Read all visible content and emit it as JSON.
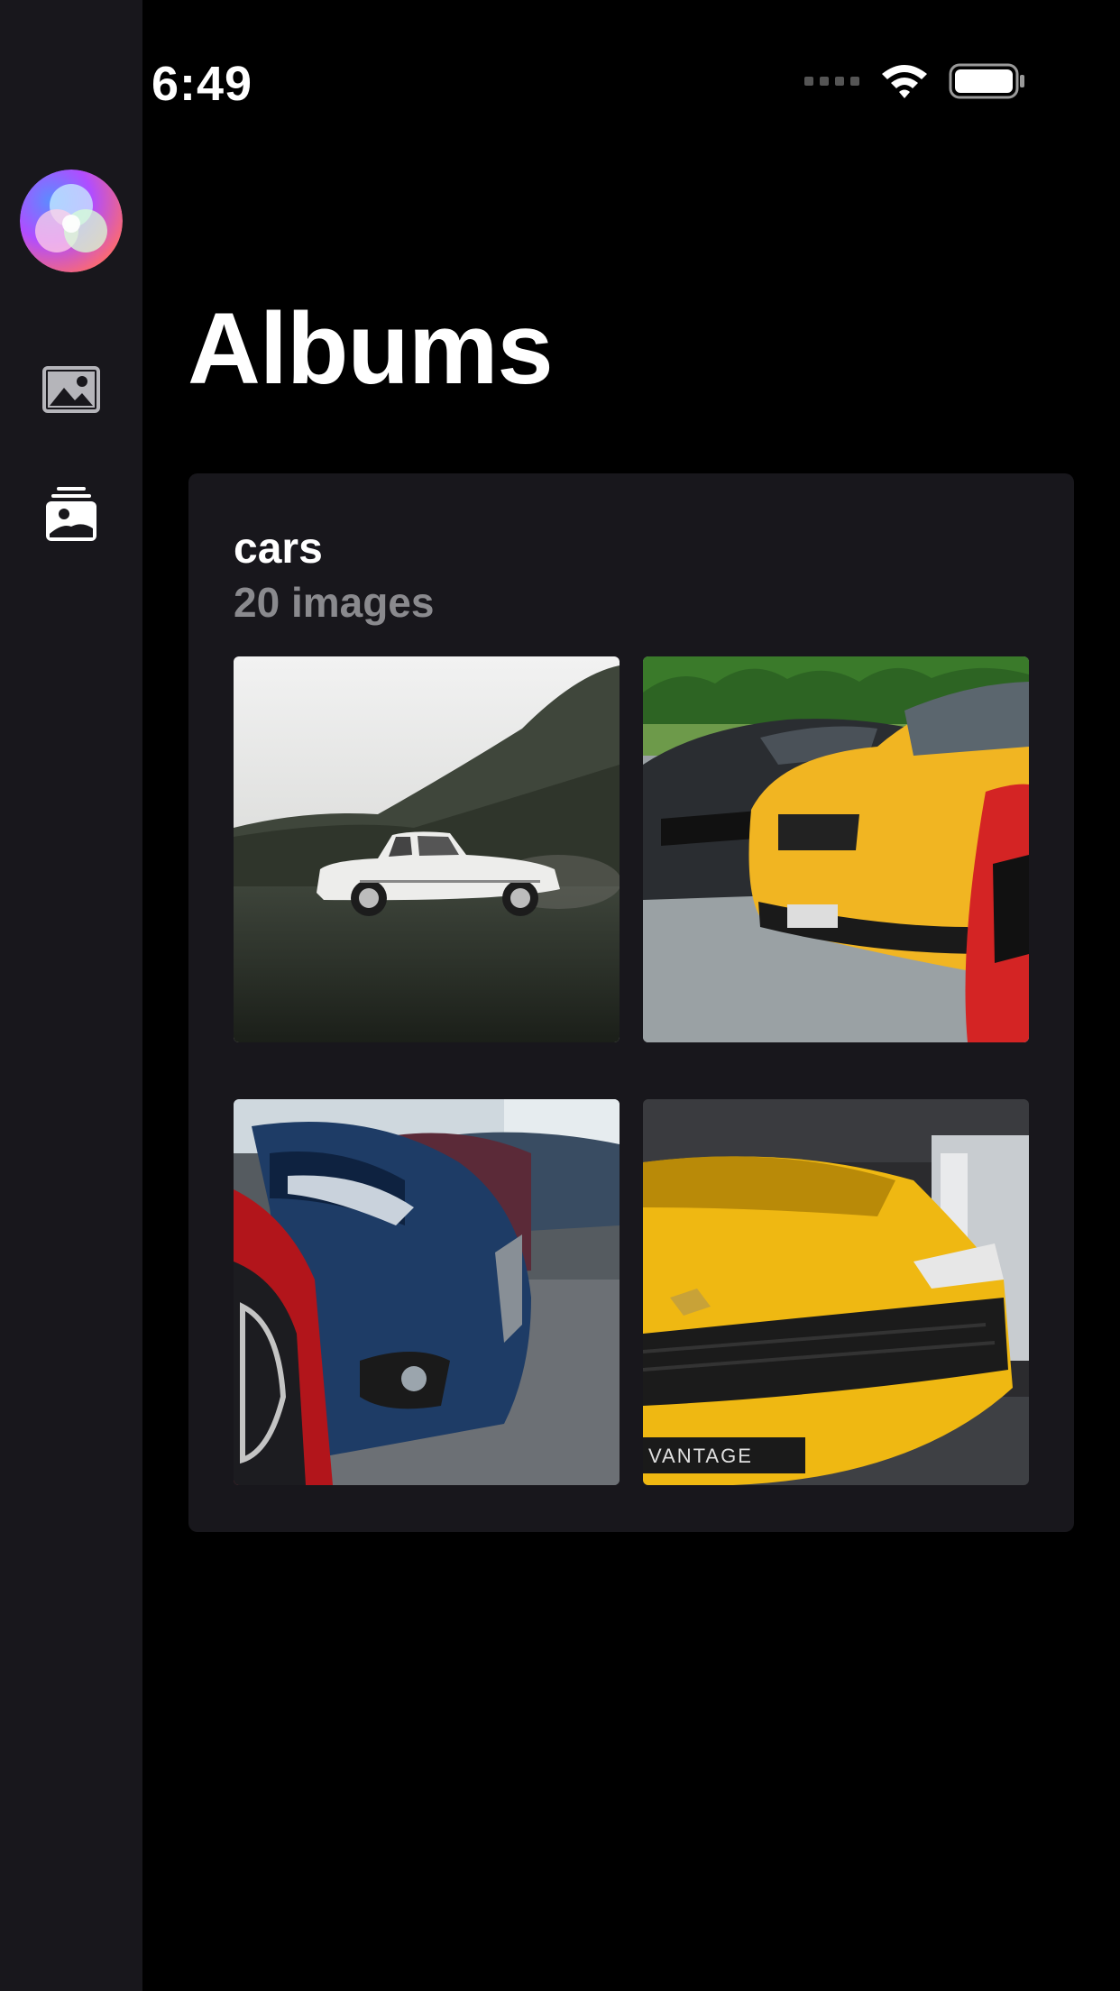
{
  "status_bar": {
    "time": "6:49"
  },
  "header": {
    "title": "Albums"
  },
  "sidebar": {
    "items": [
      {
        "icon": "photos-icon"
      },
      {
        "icon": "albums-icon"
      }
    ]
  },
  "album": {
    "name": "cars",
    "count_label": "20 images",
    "thumbnails": [
      {
        "icon": "photo-white-classic-car"
      },
      {
        "icon": "photo-mustangs-parked"
      },
      {
        "icon": "photo-row-of-blue-cars"
      },
      {
        "icon": "photo-yellow-suv"
      }
    ]
  },
  "colors": {
    "background": "#000000",
    "sidebar": "#18171c",
    "card": "#18171c",
    "secondary_text": "#8a8a8e"
  }
}
